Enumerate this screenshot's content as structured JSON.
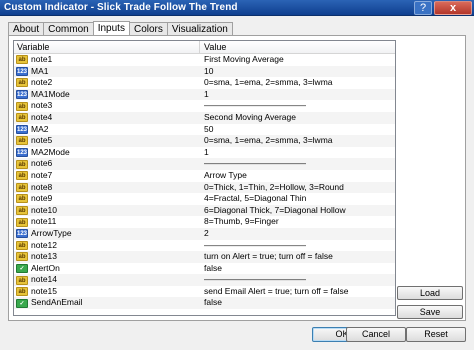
{
  "window": {
    "title": "Custom Indicator - Slick Trade Follow The Trend",
    "help_glyph": "?",
    "close_glyph": "x"
  },
  "tabs": [
    {
      "label": "About"
    },
    {
      "label": "Common"
    },
    {
      "label": "Inputs",
      "active": true
    },
    {
      "label": "Colors"
    },
    {
      "label": "Visualization"
    }
  ],
  "grid": {
    "col_variable": "Variable",
    "col_value": "Value",
    "rows": [
      {
        "name": "note1",
        "value": "First Moving Average",
        "icon": "ab"
      },
      {
        "name": "MA1",
        "value": "10",
        "icon": "123"
      },
      {
        "name": "note2",
        "value": "0=sma, 1=ema, 2=smma, 3=lwma",
        "icon": "ab"
      },
      {
        "name": "MA1Mode",
        "value": "1",
        "icon": "123"
      },
      {
        "name": "note3",
        "value": "————————————",
        "icon": "ab"
      },
      {
        "name": "note4",
        "value": "Second Moving Average",
        "icon": "ab"
      },
      {
        "name": "MA2",
        "value": "50",
        "icon": "123"
      },
      {
        "name": "note5",
        "value": "0=sma, 1=ema, 2=smma, 3=lwma",
        "icon": "ab"
      },
      {
        "name": "MA2Mode",
        "value": "1",
        "icon": "123"
      },
      {
        "name": "note6",
        "value": "————————————",
        "icon": "ab"
      },
      {
        "name": "note7",
        "value": "Arrow Type",
        "icon": "ab"
      },
      {
        "name": "note8",
        "value": "0=Thick, 1=Thin, 2=Hollow, 3=Round",
        "icon": "ab"
      },
      {
        "name": "note9",
        "value": "4=Fractal, 5=Diagonal Thin",
        "icon": "ab"
      },
      {
        "name": "note10",
        "value": "6=Diagonal Thick, 7=Diagonal Hollow",
        "icon": "ab"
      },
      {
        "name": "note11",
        "value": "8=Thumb, 9=Finger",
        "icon": "ab"
      },
      {
        "name": "ArrowType",
        "value": "2",
        "icon": "123"
      },
      {
        "name": "note12",
        "value": "————————————",
        "icon": "ab"
      },
      {
        "name": "note13",
        "value": "turn on Alert = true; turn off = false",
        "icon": "ab"
      },
      {
        "name": "AlertOn",
        "value": "false",
        "icon": "bool"
      },
      {
        "name": "note14",
        "value": "————————————",
        "icon": "ab"
      },
      {
        "name": "note15",
        "value": "send Email Alert = true; turn off = false",
        "icon": "ab"
      },
      {
        "name": "SendAnEmail",
        "value": "false",
        "icon": "bool"
      }
    ]
  },
  "side_buttons": {
    "load": "Load",
    "save": "Save"
  },
  "footer": {
    "ok": "OK",
    "cancel": "Cancel",
    "reset": "Reset"
  }
}
